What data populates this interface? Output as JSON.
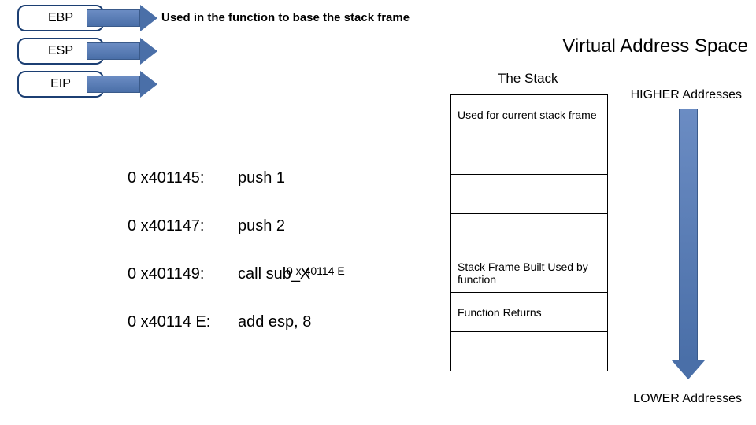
{
  "registers": {
    "ebp": {
      "label": "EBP",
      "desc": "Used in the function to base the stack frame"
    },
    "esp": {
      "label": "ESP"
    },
    "eip": {
      "label": "EIP"
    }
  },
  "titles": {
    "virtual_space": "Virtual Address Space",
    "stack": "The Stack",
    "higher": "HIGHER Addresses",
    "lower": "LOWER Addresses"
  },
  "stack_cells": {
    "c0": "Used for current stack frame",
    "c1": "",
    "c2": "",
    "c3": "",
    "c4": "Stack Frame Built Used by function",
    "c5": "Function Returns",
    "c6": ""
  },
  "instructions": {
    "r0": {
      "addr": "0 x401145:",
      "text": "push 1"
    },
    "r1": {
      "addr": "0 x401147:",
      "text": "push 2"
    },
    "r2": {
      "addr": "0 x401149:",
      "text": "call sub_X",
      "overlay": "0 x 40114 E"
    },
    "r3": {
      "addr": "0 x40114 E:",
      "text": "add esp, 8"
    }
  }
}
